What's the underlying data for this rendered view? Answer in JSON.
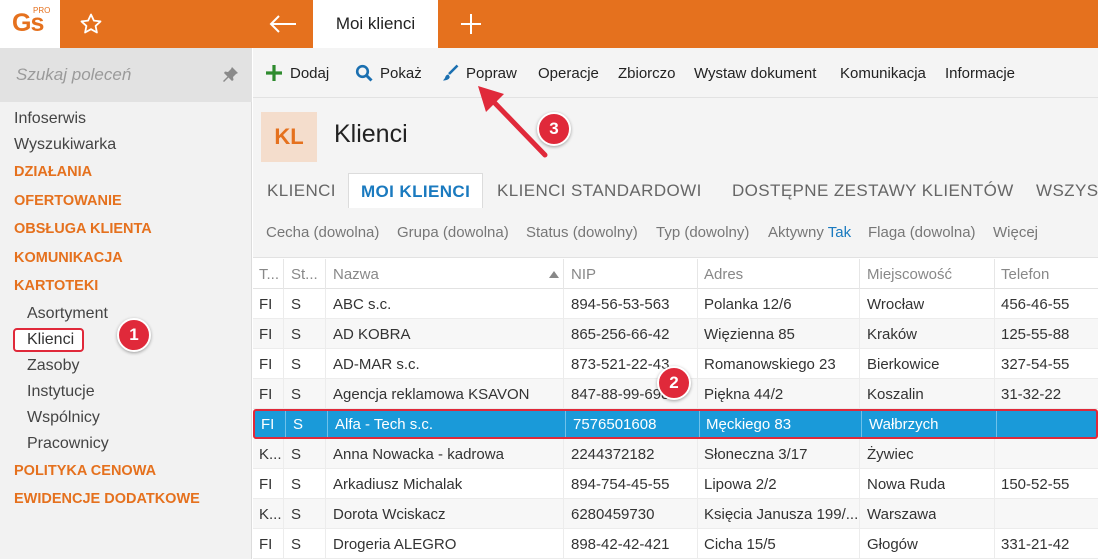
{
  "app": {
    "logo": "Gs",
    "logo_sup": "PRO",
    "active_tab": "Moi klienci"
  },
  "sidebar": {
    "search_placeholder": "Szukaj poleceń",
    "items": [
      {
        "label": "Infoserwis",
        "kind": "item"
      },
      {
        "label": "Wyszukiwarka",
        "kind": "item"
      },
      {
        "label": "DZIAŁANIA",
        "kind": "header"
      },
      {
        "label": "OFERTOWANIE",
        "kind": "header"
      },
      {
        "label": "OBSŁUGA KLIENTA",
        "kind": "header"
      },
      {
        "label": "KOMUNIKACJA",
        "kind": "header"
      },
      {
        "label": "KARTOTEKI",
        "kind": "header"
      },
      {
        "label": "Asortyment",
        "kind": "sub"
      },
      {
        "label": "Klienci",
        "kind": "sub",
        "selected": true
      },
      {
        "label": "Zasoby",
        "kind": "sub"
      },
      {
        "label": "Instytucje",
        "kind": "sub"
      },
      {
        "label": "Wspólnicy",
        "kind": "sub"
      },
      {
        "label": "Pracownicy",
        "kind": "sub"
      },
      {
        "label": "POLITYKA CENOWA",
        "kind": "header"
      },
      {
        "label": "EWIDENCJE DODATKOWE",
        "kind": "header"
      }
    ]
  },
  "toolbar": {
    "add": "Dodaj",
    "show": "Pokaż",
    "edit": "Popraw",
    "operations": "Operacje",
    "bulk": "Zbiorczo",
    "issue_document": "Wystaw dokument",
    "communication": "Komunikacja",
    "information": "Informacje"
  },
  "header": {
    "badge": "KL",
    "title": "Klienci"
  },
  "tabs": [
    {
      "label": "KLIENCI",
      "active": false
    },
    {
      "label": "MOI KLIENCI",
      "active": true
    },
    {
      "label": "KLIENCI STANDARDOWI",
      "active": false
    },
    {
      "label": "DOSTĘPNE ZESTAWY KLIENTÓW",
      "active": false
    },
    {
      "label": "WSZYST",
      "active": false
    }
  ],
  "filters": {
    "feature": "Cecha (dowolna)",
    "group": "Grupa (dowolna)",
    "status": "Status (dowolny)",
    "type": "Typ (dowolny)",
    "active_label": "Aktywny",
    "active_value": "Tak",
    "flag": "Flaga (dowolna)",
    "more": "Więcej"
  },
  "grid": {
    "columns": [
      "T...",
      "St...",
      "Nazwa",
      "NIP",
      "Adres",
      "Miejscowość",
      "Telefon"
    ],
    "rows": [
      [
        "FI",
        "S",
        "ABC s.c.",
        "894-56-53-563",
        "Polanka  12/6",
        "Wrocław",
        "456-46-55"
      ],
      [
        "FI",
        "S",
        "AD KOBRA",
        "865-256-66-42",
        "Więzienna  85",
        "Kraków",
        "125-55-88"
      ],
      [
        "FI",
        "S",
        "AD-MAR s.c.",
        "873-521-22-43",
        "Romanowskiego 23",
        "Bierkowice",
        "327-54-55"
      ],
      [
        "FI",
        "S",
        "Agencja reklamowa KSAVON",
        "847-88-99-698",
        "Piękna  44/2",
        "Koszalin",
        "31-32-22"
      ],
      [
        "FI",
        "S",
        "Alfa - Tech s.c.",
        "7576501608",
        "Męckiego  83",
        "Wałbrzych",
        ""
      ],
      [
        "K...",
        "S",
        "Anna Nowacka - kadrowa",
        "2244372182",
        "Słoneczna 3/17",
        "Żywiec",
        ""
      ],
      [
        "FI",
        "S",
        "Arkadiusz Michalak",
        "894-754-45-55",
        "Lipowa  2/2",
        "Nowa Ruda",
        "150-52-55"
      ],
      [
        "K...",
        "S",
        "Dorota Wciskacz",
        "6280459730",
        "Księcia Janusza 199/...",
        "Warszawa",
        ""
      ],
      [
        "FI",
        "S",
        "Drogeria ALEGRO",
        "898-42-42-421",
        "Cicha  15/5",
        "Głogów",
        "331-21-42"
      ]
    ],
    "selected_row": 4
  },
  "annotations": {
    "badge1": "1",
    "badge2": "2",
    "badge3": "3"
  },
  "colors": {
    "accent": "#e5711e",
    "selection": "#1a9ad9",
    "highlight": "#e0293a",
    "link": "#1a7abf"
  }
}
